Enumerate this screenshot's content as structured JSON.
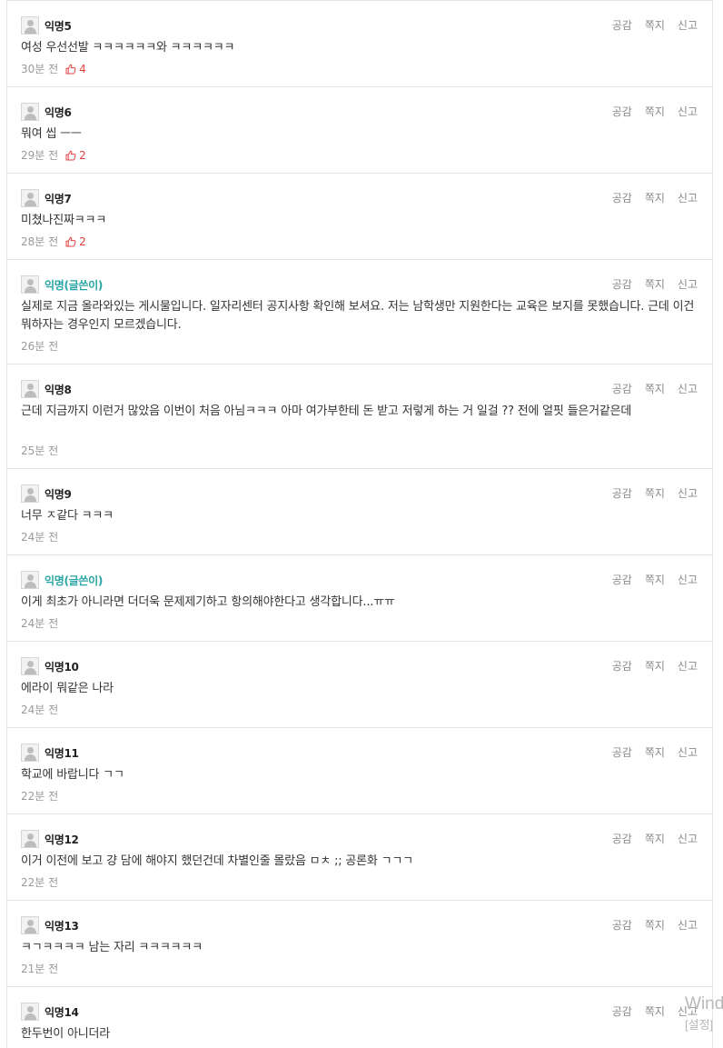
{
  "actions": {
    "like": "공감",
    "message": "쪽지",
    "report": "신고"
  },
  "comments": [
    {
      "nick": "익명5",
      "author": false,
      "text": "여성 우선선발 ㅋㅋㅋㅋㅋㅋ와 ㅋㅋㅋㅋㅋㅋ",
      "time": "30분 전",
      "likes": "4"
    },
    {
      "nick": "익명6",
      "author": false,
      "text": "뭐여 씹 ㅡㅡ",
      "time": "29분 전",
      "likes": "2"
    },
    {
      "nick": "익명7",
      "author": false,
      "text": "미쳤나진짜ㅋㅋㅋ",
      "time": "28분 전",
      "likes": "2"
    },
    {
      "nick": "익명(글쓴이)",
      "author": true,
      "text": "실제로 지금 올라와있는 게시물입니다. 일자리센터 공지사항 확인해 보셔요. 저는 남학생만 지원한다는 교육은 보지를 못했습니다. 근데 이건 뭐하자는 경우인지 모르겠습니다.",
      "time": "26분 전",
      "likes": null
    },
    {
      "nick": "익명8",
      "author": false,
      "text": "근데 지금까지 이런거 많았음 이번이 처음 아님ㅋㅋㅋ 아마 여가부한테 돈 받고 저렇게 하는 거 일걸 ?? 전에 얼핏 들은거같은데",
      "time": "25분 전",
      "likes": null
    },
    {
      "nick": "익명9",
      "author": false,
      "text": "너무 ㅈ같다 ㅋㅋㅋ",
      "time": "24분 전",
      "likes": null
    },
    {
      "nick": "익명(글쓴이)",
      "author": true,
      "text": "이게 최초가 아니라면 더더욱 문제제기하고 항의해야한다고 생각합니다...ㅠㅠ",
      "time": "24분 전",
      "likes": null
    },
    {
      "nick": "익명10",
      "author": false,
      "text": "에라이 뭐같은 나라",
      "time": "24분 전",
      "likes": null
    },
    {
      "nick": "익명11",
      "author": false,
      "text": "학교에 바랍니다 ㄱㄱ",
      "time": "22분 전",
      "likes": null
    },
    {
      "nick": "익명12",
      "author": false,
      "text": "이거 이전에 보고 걍 담에 해야지 했던건데 차별인줄 몰랐음 ㅁㅊ ;; 공론화 ㄱㄱㄱ",
      "time": "22분 전",
      "likes": null
    },
    {
      "nick": "익명13",
      "author": false,
      "text": "ㅋㄱㅋㅋㅋㅋ 남는 자리 ㅋㅋㅋㅋㅋㅋ",
      "time": "21분 전",
      "likes": null
    },
    {
      "nick": "익명14",
      "author": false,
      "text": "한두번이 아니더라",
      "time": "",
      "likes": null
    }
  ],
  "watermark": {
    "line1": "Wind",
    "line2": "[설정]"
  }
}
